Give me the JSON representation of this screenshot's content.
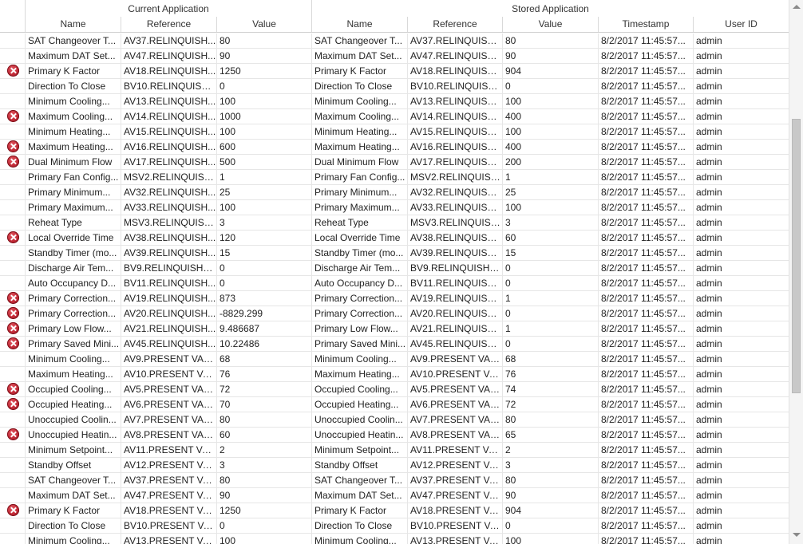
{
  "groups": {
    "current": "Current Application",
    "stored": "Stored Application"
  },
  "columns": [
    "Name",
    "Reference",
    "Value",
    "Name",
    "Reference",
    "Value",
    "Timestamp",
    "User ID"
  ],
  "rows": [
    {
      "err": false,
      "cname": "SAT Changeover T...",
      "cref": "AV37.RELINQUISH...",
      "cval": "80",
      "sname": "SAT Changeover T...",
      "sref": "AV37.RELINQUISH...",
      "sval": "80",
      "ts": "8/2/2017 11:45:57...",
      "user": "admin"
    },
    {
      "err": false,
      "cname": "Maximum DAT Set...",
      "cref": "AV47.RELINQUISH...",
      "cval": "90",
      "sname": "Maximum DAT Set...",
      "sref": "AV47.RELINQUISH...",
      "sval": "90",
      "ts": "8/2/2017 11:45:57...",
      "user": "admin"
    },
    {
      "err": true,
      "cname": "Primary K Factor",
      "cref": "AV18.RELINQUISH...",
      "cval": "1250",
      "sname": "Primary K Factor",
      "sref": "AV18.RELINQUISH...",
      "sval": "904",
      "ts": "8/2/2017 11:45:57...",
      "user": "admin"
    },
    {
      "err": false,
      "cname": "Direction To Close",
      "cref": "BV10.RELINQUISH...",
      "cval": "0",
      "sname": "Direction To Close",
      "sref": "BV10.RELINQUISH...",
      "sval": "0",
      "ts": "8/2/2017 11:45:57...",
      "user": "admin"
    },
    {
      "err": false,
      "cname": "Minimum Cooling...",
      "cref": "AV13.RELINQUISH...",
      "cval": "100",
      "sname": "Minimum Cooling...",
      "sref": "AV13.RELINQUISH...",
      "sval": "100",
      "ts": "8/2/2017 11:45:57...",
      "user": "admin"
    },
    {
      "err": true,
      "cname": "Maximum Cooling...",
      "cref": "AV14.RELINQUISH...",
      "cval": "1000",
      "sname": "Maximum Cooling...",
      "sref": "AV14.RELINQUISH...",
      "sval": "400",
      "ts": "8/2/2017 11:45:57...",
      "user": "admin"
    },
    {
      "err": false,
      "cname": "Minimum Heating...",
      "cref": "AV15.RELINQUISH...",
      "cval": "100",
      "sname": "Minimum Heating...",
      "sref": "AV15.RELINQUISH...",
      "sval": "100",
      "ts": "8/2/2017 11:45:57...",
      "user": "admin"
    },
    {
      "err": true,
      "cname": "Maximum Heating...",
      "cref": "AV16.RELINQUISH...",
      "cval": "600",
      "sname": "Maximum Heating...",
      "sref": "AV16.RELINQUISH...",
      "sval": "400",
      "ts": "8/2/2017 11:45:57...",
      "user": "admin"
    },
    {
      "err": true,
      "cname": "Dual Minimum Flow",
      "cref": "AV17.RELINQUISH...",
      "cval": "500",
      "sname": "Dual Minimum Flow",
      "sref": "AV17.RELINQUISH...",
      "sval": "200",
      "ts": "8/2/2017 11:45:57...",
      "user": "admin"
    },
    {
      "err": false,
      "cname": "Primary Fan Config...",
      "cref": "MSV2.RELINQUISH...",
      "cval": "1",
      "sname": "Primary Fan Config...",
      "sref": "MSV2.RELINQUISH...",
      "sval": "1",
      "ts": "8/2/2017 11:45:57...",
      "user": "admin"
    },
    {
      "err": false,
      "cname": "Primary Minimum...",
      "cref": "AV32.RELINQUISH...",
      "cval": "25",
      "sname": "Primary Minimum...",
      "sref": "AV32.RELINQUISH...",
      "sval": "25",
      "ts": "8/2/2017 11:45:57...",
      "user": "admin"
    },
    {
      "err": false,
      "cname": "Primary Maximum...",
      "cref": "AV33.RELINQUISH...",
      "cval": "100",
      "sname": "Primary Maximum...",
      "sref": "AV33.RELINQUISH...",
      "sval": "100",
      "ts": "8/2/2017 11:45:57...",
      "user": "admin"
    },
    {
      "err": false,
      "cname": "Reheat Type",
      "cref": "MSV3.RELINQUISH...",
      "cval": "3",
      "sname": "Reheat Type",
      "sref": "MSV3.RELINQUISH...",
      "sval": "3",
      "ts": "8/2/2017 11:45:57...",
      "user": "admin"
    },
    {
      "err": true,
      "cname": "Local Override Time",
      "cref": "AV38.RELINQUISH...",
      "cval": "120",
      "sname": "Local Override Time",
      "sref": "AV38.RELINQUISH...",
      "sval": "60",
      "ts": "8/2/2017 11:45:57...",
      "user": "admin"
    },
    {
      "err": false,
      "cname": "Standby Timer (mo...",
      "cref": "AV39.RELINQUISH...",
      "cval": "15",
      "sname": "Standby Timer (mo...",
      "sref": "AV39.RELINQUISH...",
      "sval": "15",
      "ts": "8/2/2017 11:45:57...",
      "user": "admin"
    },
    {
      "err": false,
      "cname": "Discharge Air Tem...",
      "cref": "BV9.RELINQUISH_D...",
      "cval": "0",
      "sname": "Discharge Air Tem...",
      "sref": "BV9.RELINQUISH_D...",
      "sval": "0",
      "ts": "8/2/2017 11:45:57...",
      "user": "admin"
    },
    {
      "err": false,
      "cname": "Auto Occupancy D...",
      "cref": "BV11.RELINQUISH...",
      "cval": "0",
      "sname": "Auto Occupancy D...",
      "sref": "BV11.RELINQUISH...",
      "sval": "0",
      "ts": "8/2/2017 11:45:57...",
      "user": "admin"
    },
    {
      "err": true,
      "cname": "Primary Correction...",
      "cref": "AV19.RELINQUISH...",
      "cval": "873",
      "sname": "Primary Correction...",
      "sref": "AV19.RELINQUISH...",
      "sval": "1",
      "ts": "8/2/2017 11:45:57...",
      "user": "admin"
    },
    {
      "err": true,
      "cname": "Primary Correction...",
      "cref": "AV20.RELINQUISH...",
      "cval": "-8829.299",
      "sname": "Primary Correction...",
      "sref": "AV20.RELINQUISH...",
      "sval": "0",
      "ts": "8/2/2017 11:45:57...",
      "user": "admin"
    },
    {
      "err": true,
      "cname": "Primary Low Flow...",
      "cref": "AV21.RELINQUISH...",
      "cval": "9.486687",
      "sname": "Primary Low Flow...",
      "sref": "AV21.RELINQUISH...",
      "sval": "1",
      "ts": "8/2/2017 11:45:57...",
      "user": "admin"
    },
    {
      "err": true,
      "cname": "Primary Saved Mini...",
      "cref": "AV45.RELINQUISH...",
      "cval": "10.22486",
      "sname": "Primary Saved Mini...",
      "sref": "AV45.RELINQUISH...",
      "sval": "0",
      "ts": "8/2/2017 11:45:57...",
      "user": "admin"
    },
    {
      "err": false,
      "cname": "Minimum Cooling...",
      "cref": "AV9.PRESENT VALUE",
      "cval": "68",
      "sname": "Minimum Cooling...",
      "sref": "AV9.PRESENT VALUE",
      "sval": "68",
      "ts": "8/2/2017 11:45:57...",
      "user": "admin"
    },
    {
      "err": false,
      "cname": "Maximum Heating...",
      "cref": "AV10.PRESENT VALUE",
      "cval": "76",
      "sname": "Maximum Heating...",
      "sref": "AV10.PRESENT VALUE",
      "sval": "76",
      "ts": "8/2/2017 11:45:57...",
      "user": "admin"
    },
    {
      "err": true,
      "cname": "Occupied Cooling...",
      "cref": "AV5.PRESENT VALUE",
      "cval": "72",
      "sname": "Occupied Cooling...",
      "sref": "AV5.PRESENT VALUE",
      "sval": "74",
      "ts": "8/2/2017 11:45:57...",
      "user": "admin"
    },
    {
      "err": true,
      "cname": "Occupied Heating...",
      "cref": "AV6.PRESENT VALUE",
      "cval": "70",
      "sname": "Occupied Heating...",
      "sref": "AV6.PRESENT VALUE",
      "sval": "72",
      "ts": "8/2/2017 11:45:57...",
      "user": "admin"
    },
    {
      "err": false,
      "cname": "Unoccupied Coolin...",
      "cref": "AV7.PRESENT VALUE",
      "cval": "80",
      "sname": "Unoccupied Coolin...",
      "sref": "AV7.PRESENT VALUE",
      "sval": "80",
      "ts": "8/2/2017 11:45:57...",
      "user": "admin"
    },
    {
      "err": true,
      "cname": "Unoccupied Heatin...",
      "cref": "AV8.PRESENT VALUE",
      "cval": "60",
      "sname": "Unoccupied Heatin...",
      "sref": "AV8.PRESENT VALUE",
      "sval": "65",
      "ts": "8/2/2017 11:45:57...",
      "user": "admin"
    },
    {
      "err": false,
      "cname": "Minimum Setpoint...",
      "cref": "AV11.PRESENT VAL...",
      "cval": "2",
      "sname": "Minimum Setpoint...",
      "sref": "AV11.PRESENT VAL...",
      "sval": "2",
      "ts": "8/2/2017 11:45:57...",
      "user": "admin"
    },
    {
      "err": false,
      "cname": "Standby Offset",
      "cref": "AV12.PRESENT VAL...",
      "cval": "3",
      "sname": "Standby Offset",
      "sref": "AV12.PRESENT VAL...",
      "sval": "3",
      "ts": "8/2/2017 11:45:57...",
      "user": "admin"
    },
    {
      "err": false,
      "cname": "SAT Changeover T...",
      "cref": "AV37.PRESENT VAL...",
      "cval": "80",
      "sname": "SAT Changeover T...",
      "sref": "AV37.PRESENT VA...",
      "sval": "80",
      "ts": "8/2/2017 11:45:57...",
      "user": "admin"
    },
    {
      "err": false,
      "cname": "Maximum DAT Set...",
      "cref": "AV47.PRESENT VAL...",
      "cval": "90",
      "sname": "Maximum DAT Set...",
      "sref": "AV47.PRESENT VA...",
      "sval": "90",
      "ts": "8/2/2017 11:45:57...",
      "user": "admin"
    },
    {
      "err": true,
      "cname": "Primary K Factor",
      "cref": "AV18.PRESENT VAL...",
      "cval": "1250",
      "sname": "Primary K Factor",
      "sref": "AV18.PRESENT VA...",
      "sval": "904",
      "ts": "8/2/2017 11:45:57...",
      "user": "admin"
    },
    {
      "err": false,
      "cname": "Direction To Close",
      "cref": "BV10.PRESENT VAL...",
      "cval": "0",
      "sname": "Direction To Close",
      "sref": "BV10.PRESENT VAL...",
      "sval": "0",
      "ts": "8/2/2017 11:45:57...",
      "user": "admin"
    },
    {
      "err": false,
      "cname": "Minimum Cooling...",
      "cref": "AV13.PRESENT VAL...",
      "cval": "100",
      "sname": "Minimum Cooling...",
      "sref": "AV13.PRESENT VA...",
      "sval": "100",
      "ts": "8/2/2017 11:45:57...",
      "user": "admin"
    }
  ],
  "icons": {
    "mismatch": "error-x-circle-icon"
  },
  "colors": {
    "mismatch_icon": "#c22a37",
    "grid_line": "#e6e6e6",
    "header_text": "#333333"
  }
}
